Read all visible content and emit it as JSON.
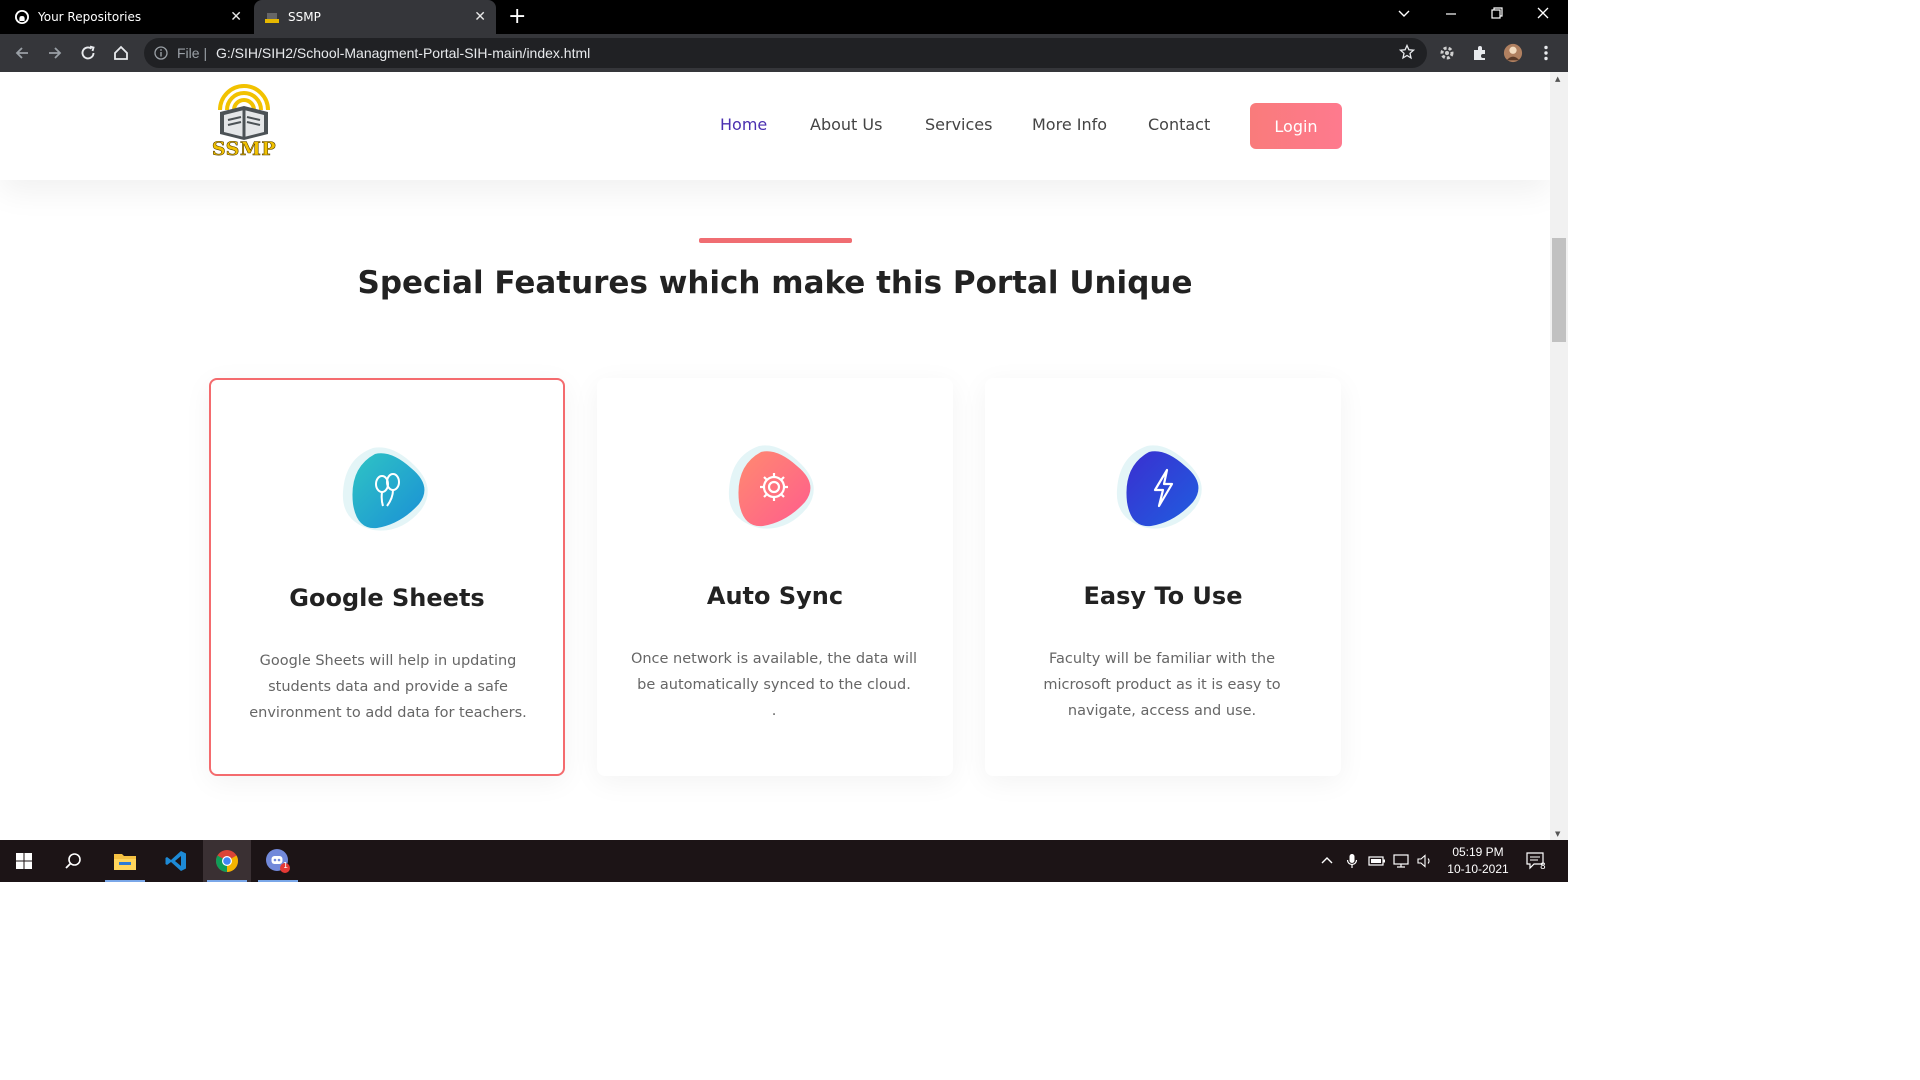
{
  "browser": {
    "tabs": [
      {
        "title": "Your Repositories",
        "icon": "github-icon",
        "active": false
      },
      {
        "title": "SSMP",
        "icon": "ssmp-favicon",
        "active": true
      }
    ],
    "address": {
      "prefix": "File",
      "url": "G:/SIH/SIH2/School-Managment-Portal-SIH-main/index.html"
    }
  },
  "site": {
    "logo_text": "SSMP",
    "nav": {
      "items": [
        {
          "label": "Home",
          "active": true
        },
        {
          "label": "About Us",
          "active": false
        },
        {
          "label": "Services",
          "active": false
        },
        {
          "label": "More Info",
          "active": false
        },
        {
          "label": "Contact",
          "active": false
        }
      ],
      "login_label": "Login"
    },
    "section": {
      "heading": "Special Features which make this Portal Unique",
      "cards": [
        {
          "title": "Google Sheets",
          "desc": "Google Sheets will help in updating students data and provide a safe environment to add data for teachers.",
          "icon": "balloons-icon",
          "color_from": "#2fc4c4",
          "color_to": "#1a8fd6",
          "highlighted": true
        },
        {
          "title": "Auto Sync",
          "desc": "Once network is available, the data will be automatically synced to the cloud.\n.",
          "icon": "gear-icon",
          "color_from": "#ff8a70",
          "color_to": "#ff5c8d",
          "highlighted": false
        },
        {
          "title": "Easy To Use",
          "desc": "Faculty will be familiar with the microsoft product as it is easy to navigate, access and use.",
          "icon": "lightning-icon",
          "color_from": "#3a2fd0",
          "color_to": "#1f5ee0",
          "highlighted": false
        }
      ]
    },
    "colors": {
      "accent": "#f06d72",
      "nav_active": "#4a2fb0",
      "login_from": "#f97b7b",
      "login_to": "#fe7a8e"
    }
  },
  "taskbar": {
    "apps": [
      "windows-start-icon",
      "search-icon",
      "file-explorer-icon",
      "vscode-icon",
      "chrome-icon",
      "discord-icon"
    ],
    "discord_badge": "1",
    "time": "05:19 PM",
    "date": "10-10-2021",
    "notification_count": "8"
  }
}
